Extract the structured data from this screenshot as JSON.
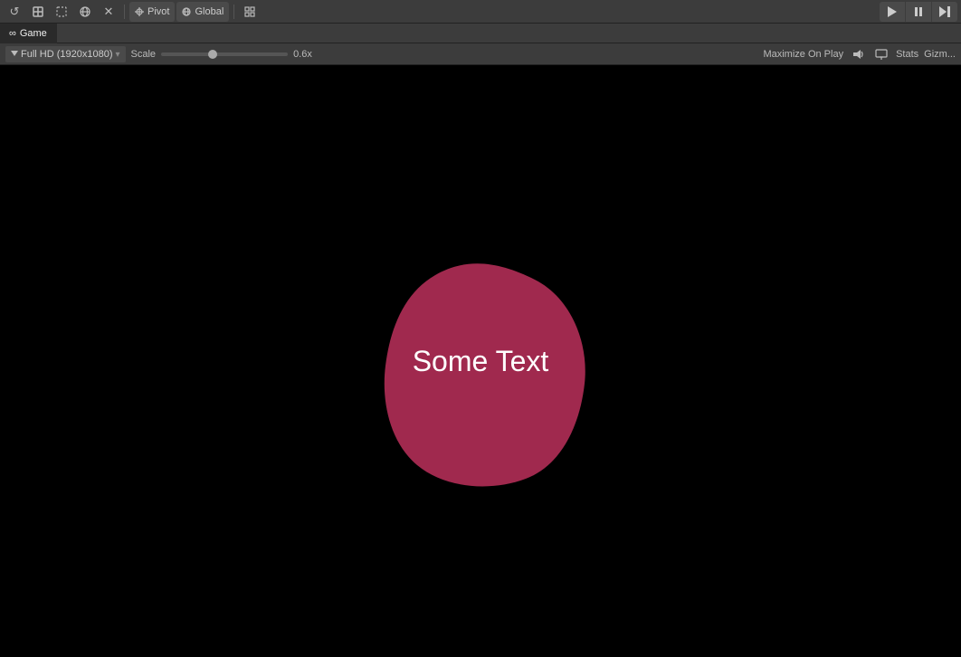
{
  "topToolbar": {
    "icons": [
      "↺",
      "□",
      "⊞",
      "☼",
      "✕"
    ],
    "pivotLabel": "Pivot",
    "globalLabel": "Global",
    "gridLabel": "⊞",
    "playBtn": "▶",
    "pauseBtn": "⏸",
    "stepBtn": "⏭"
  },
  "tabs": [
    {
      "label": "Game",
      "icon": "∞",
      "active": true
    }
  ],
  "gameToolbar": {
    "resolution": "Full HD (1920x1080)",
    "scaleLabel": "Scale",
    "scaleValue": "0.6x",
    "sliderPercent": 40,
    "maximizeLabel": "Maximize On Play",
    "statsLabel": "Stats",
    "gizmosLabel": "Gizm..."
  },
  "viewport": {
    "blobText": "Some Text",
    "blobColor": "#a0294e"
  }
}
